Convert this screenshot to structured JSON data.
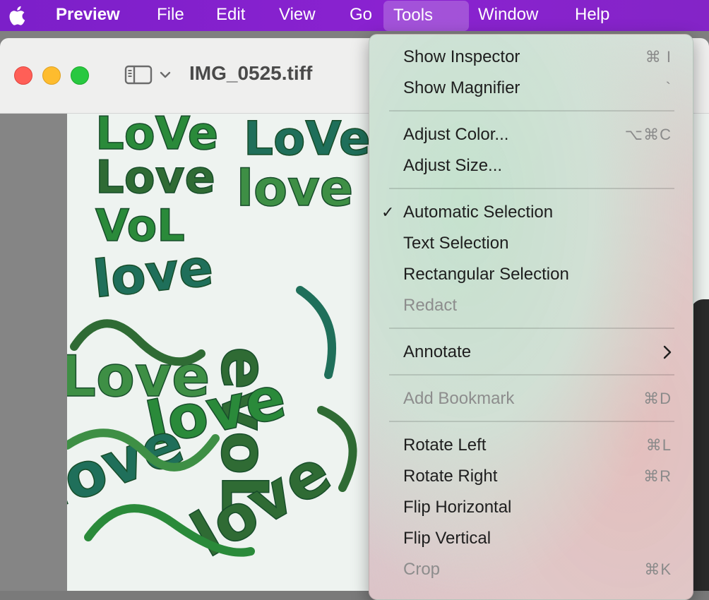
{
  "menubar": {
    "apple_icon": "apple-logo-icon",
    "app_name": "Preview",
    "items": [
      "File",
      "Edit",
      "View",
      "Go",
      "Tools",
      "Window",
      "Help"
    ],
    "active_menu": "Tools",
    "background": "#8424c7"
  },
  "window": {
    "title": "IMG_0525.tiff",
    "traffic_lights": {
      "close": "#ff5f57",
      "minimize": "#febc2e",
      "zoom": "#28c840"
    },
    "sidebar_toggle_icon": "sidebar-icon",
    "chevron_icon": "chevron-down-icon"
  },
  "image": {
    "words": [
      "LoVe",
      "LoVe",
      "Love",
      "love",
      "VoL",
      "love",
      "evoL",
      "Love",
      "love",
      "love",
      "love"
    ],
    "ink_colors": [
      "#2a8a3a",
      "#1f6f5a",
      "#2f6b34",
      "#3e8f45"
    ]
  },
  "tools_menu": {
    "items": [
      {
        "label": "Show Inspector",
        "shortcut": "⌘ I",
        "enabled": true
      },
      {
        "label": "Show Magnifier",
        "shortcut": "`",
        "enabled": true
      },
      {
        "label": "Adjust Color...",
        "shortcut": "⌥⌘C",
        "enabled": true
      },
      {
        "label": "Adjust Size...",
        "shortcut": "",
        "enabled": true
      },
      {
        "label": "Automatic Selection",
        "shortcut": "",
        "enabled": true,
        "checked": true
      },
      {
        "label": "Text Selection",
        "shortcut": "",
        "enabled": true
      },
      {
        "label": "Rectangular Selection",
        "shortcut": "",
        "enabled": true
      },
      {
        "label": "Redact",
        "shortcut": "",
        "enabled": false
      },
      {
        "label": "Annotate",
        "shortcut": "",
        "enabled": true,
        "submenu": true
      },
      {
        "label": "Add Bookmark",
        "shortcut": "⌘D",
        "enabled": false
      },
      {
        "label": "Rotate Left",
        "shortcut": "⌘L",
        "enabled": true
      },
      {
        "label": "Rotate Right",
        "shortcut": "⌘R",
        "enabled": true
      },
      {
        "label": "Flip Horizontal",
        "shortcut": "",
        "enabled": true
      },
      {
        "label": "Flip Vertical",
        "shortcut": "",
        "enabled": true
      },
      {
        "label": "Crop",
        "shortcut": "⌘K",
        "enabled": false
      }
    ],
    "checkmark": "✓"
  }
}
